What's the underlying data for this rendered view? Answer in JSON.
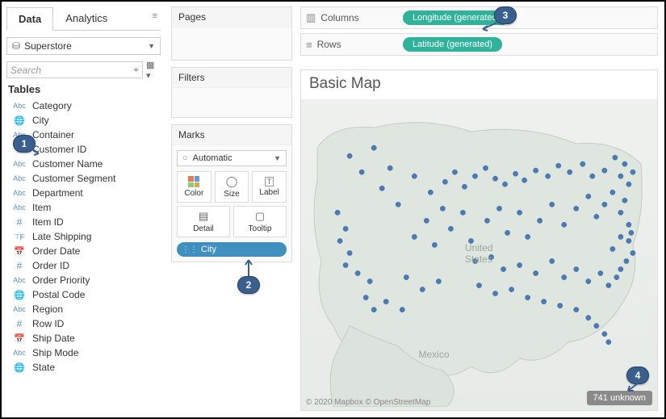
{
  "tabs": {
    "data": "Data",
    "analytics": "Analytics"
  },
  "datasource": "Superstore",
  "search_placeholder": "Search",
  "tables_label": "Tables",
  "fields": [
    {
      "icon": "abc",
      "name": "Category"
    },
    {
      "icon": "globe",
      "name": "City"
    },
    {
      "icon": "abc",
      "name": "Container"
    },
    {
      "icon": "hash",
      "name": "Customer ID"
    },
    {
      "icon": "abc",
      "name": "Customer Name"
    },
    {
      "icon": "abc",
      "name": "Customer Segment"
    },
    {
      "icon": "abc",
      "name": "Department"
    },
    {
      "icon": "abc",
      "name": "Item"
    },
    {
      "icon": "hash",
      "name": "Item ID"
    },
    {
      "icon": "tf",
      "name": "Late Shipping"
    },
    {
      "icon": "date",
      "name": "Order Date"
    },
    {
      "icon": "hash",
      "name": "Order ID"
    },
    {
      "icon": "abc",
      "name": "Order Priority"
    },
    {
      "icon": "globe",
      "name": "Postal Code"
    },
    {
      "icon": "abc",
      "name": "Region"
    },
    {
      "icon": "hash",
      "name": "Row ID"
    },
    {
      "icon": "date",
      "name": "Ship Date"
    },
    {
      "icon": "abc",
      "name": "Ship Mode"
    },
    {
      "icon": "globe",
      "name": "State"
    }
  ],
  "shelves": {
    "pages": "Pages",
    "filters": "Filters",
    "marks": "Marks",
    "mark_type": "Automatic",
    "color": "Color",
    "size": "Size",
    "label": "Label",
    "detail": "Detail",
    "tooltip": "Tooltip",
    "detail_pill": "City"
  },
  "columns_label": "Columns",
  "rows_label": "Rows",
  "columns_pill": "Longitude (generated)",
  "rows_pill": "Latitude (generated)",
  "map": {
    "title": "Basic Map",
    "country1": "United",
    "country2": "States",
    "country_mx": "Mexico",
    "attribution": "© 2020 Mapbox © OpenStreetMap",
    "unknown": "741 unknown"
  },
  "callouts": {
    "c1": "1",
    "c2": "2",
    "c3": "3",
    "c4": "4"
  }
}
